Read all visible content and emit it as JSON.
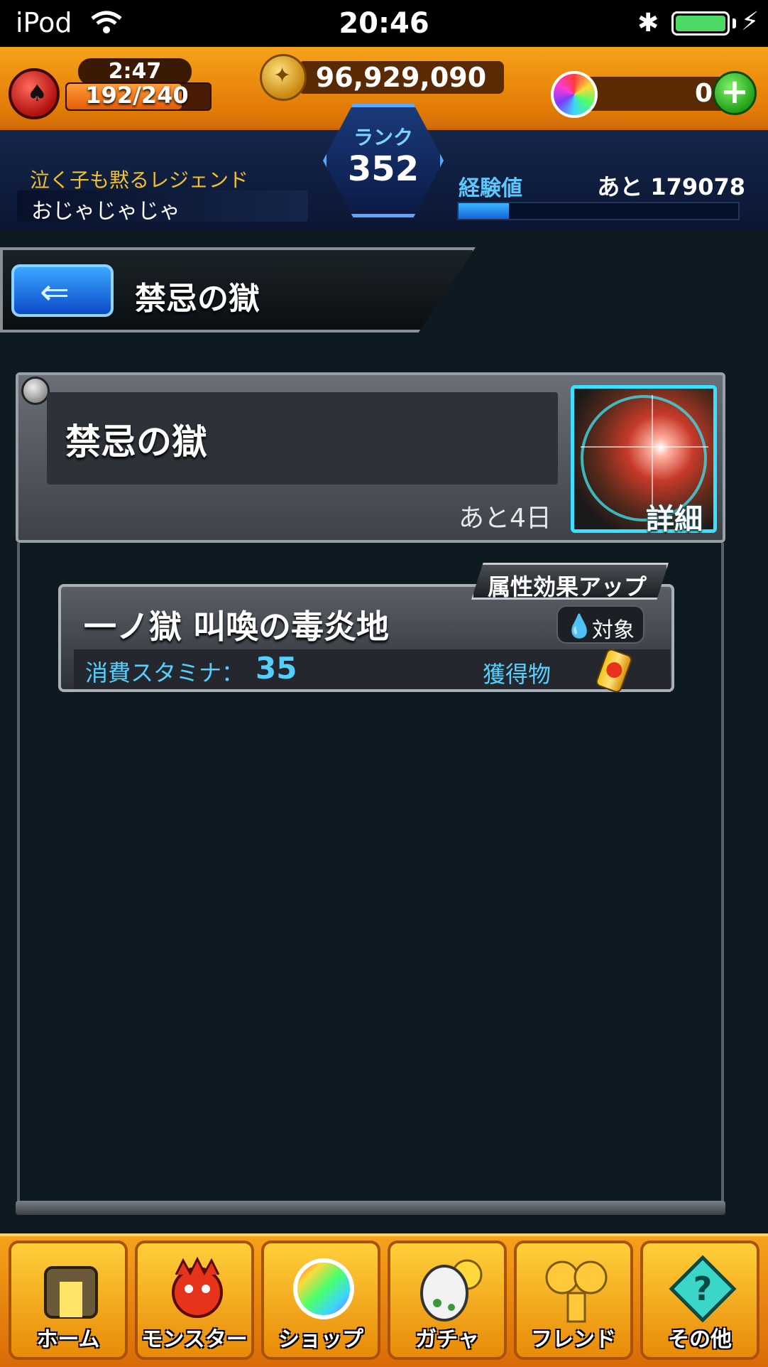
{
  "status_bar": {
    "carrier": "iPod",
    "time": "20:46"
  },
  "header": {
    "stamina": {
      "timer": "2:47",
      "current_max": "192/240",
      "fill_fraction": 0.8
    },
    "coins": "96,929,090",
    "orbs": "0",
    "rank": {
      "label": "ランク",
      "value": "352"
    },
    "player": {
      "title": "泣く子も黙るレジェンド",
      "name": "おじゃじゃじゃ"
    },
    "experience": {
      "label": "経験値",
      "remaining": "あと 179078",
      "fill_fraction": 0.18
    }
  },
  "page": {
    "back_icon": "arrow-left-icon",
    "title": "禁忌の獄"
  },
  "quest_card": {
    "title": "禁忌の獄",
    "remaining": "あと4日",
    "detail_label": "詳細"
  },
  "stage": {
    "tag": "属性効果アップ",
    "title": "一ノ獄 叫喚の毒炎地",
    "target_label": "対象",
    "stamina_label": "消費スタミナ：",
    "stamina_value": "35",
    "reward_label": "獲得物"
  },
  "nav": {
    "items": [
      {
        "label": "ホーム",
        "icon": "home-gate-icon"
      },
      {
        "label": "モンスター",
        "icon": "monster-icon"
      },
      {
        "label": "ショップ",
        "icon": "orb-icon"
      },
      {
        "label": "ガチャ",
        "icon": "egg-icon"
      },
      {
        "label": "フレンド",
        "icon": "balloons-icon"
      },
      {
        "label": "その他",
        "icon": "question-icon"
      }
    ]
  },
  "colors": {
    "header_orange": "#f7a21a",
    "accent_blue": "#54d0ff",
    "title_gold": "#f2c02a"
  }
}
